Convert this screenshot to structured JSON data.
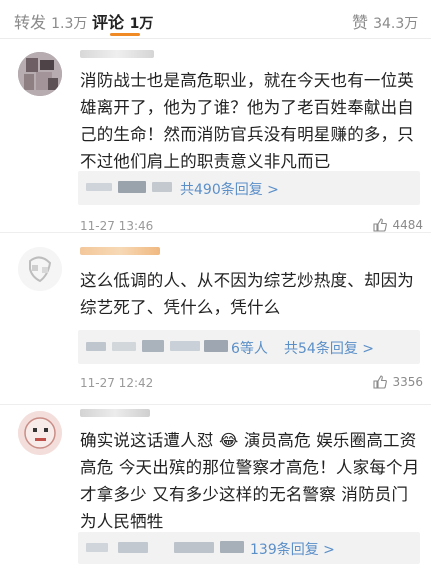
{
  "tabs": {
    "repost": {
      "label": "转发",
      "count": "1.3万"
    },
    "comment": {
      "label": "评论",
      "count": "1万"
    },
    "like": {
      "label": "赞",
      "count": "34.3万"
    }
  },
  "comments": [
    {
      "text": "消防战士也是高危职业，就在今天也有一位英雄离开了，他为了谁？他为了老百姓奉献出自己的生命！然而消防官兵没有明星赚的多，只不过他们肩上的职责意义非凡而已",
      "reply_summary": "共490条回复 >",
      "time": "11-27 13:46",
      "likes": "4484"
    },
    {
      "text": "这么低调的人、从不因为综艺炒热度、却因为综艺死了、凭什么，凭什么",
      "reply_people": "6等人",
      "reply_summary": "共54条回复 >",
      "time": "11-27 12:42",
      "likes": "3356"
    },
    {
      "text": "确实说这话遭人怼 😂 演员高危 娱乐圈高工资高危 今天出殡的那位警察才高危！人家每个月才拿多少 又有多少这样的无名警察 消防员门 为人民牺牲",
      "reply_summary": "139条回复 >"
    }
  ],
  "colors": {
    "accent": "#f08a24",
    "link": "#5b8fc8",
    "meta": "#9a9a9a"
  }
}
